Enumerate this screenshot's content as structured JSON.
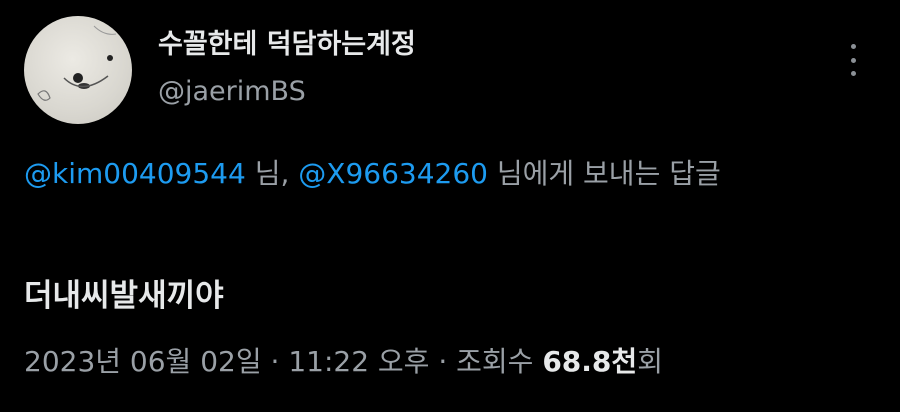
{
  "author": {
    "display_name": "수꼴한테 덕담하는계정",
    "handle": "@jaerimBS"
  },
  "reply": {
    "mention_1": "@kim00409544",
    "suffix_1": " 님, ",
    "mention_2": "@X96634260",
    "suffix_2": " 님에게 보내는 답글"
  },
  "tweet": {
    "text": "더내씨발새끼야"
  },
  "meta": {
    "date": "2023년 06월 02일",
    "separator_1": " · ",
    "time": "11:22 오후",
    "separator_2": " · ",
    "views_label": "조회수 ",
    "views_count": "68.8천",
    "views_unit": "회"
  },
  "icons": {
    "more": "more-vertical-icon",
    "avatar": "seal-avatar"
  },
  "colors": {
    "background": "#000000",
    "text_primary": "#e7e9ea",
    "text_secondary": "#9aa0a6",
    "mention": "#1d9bf0"
  }
}
